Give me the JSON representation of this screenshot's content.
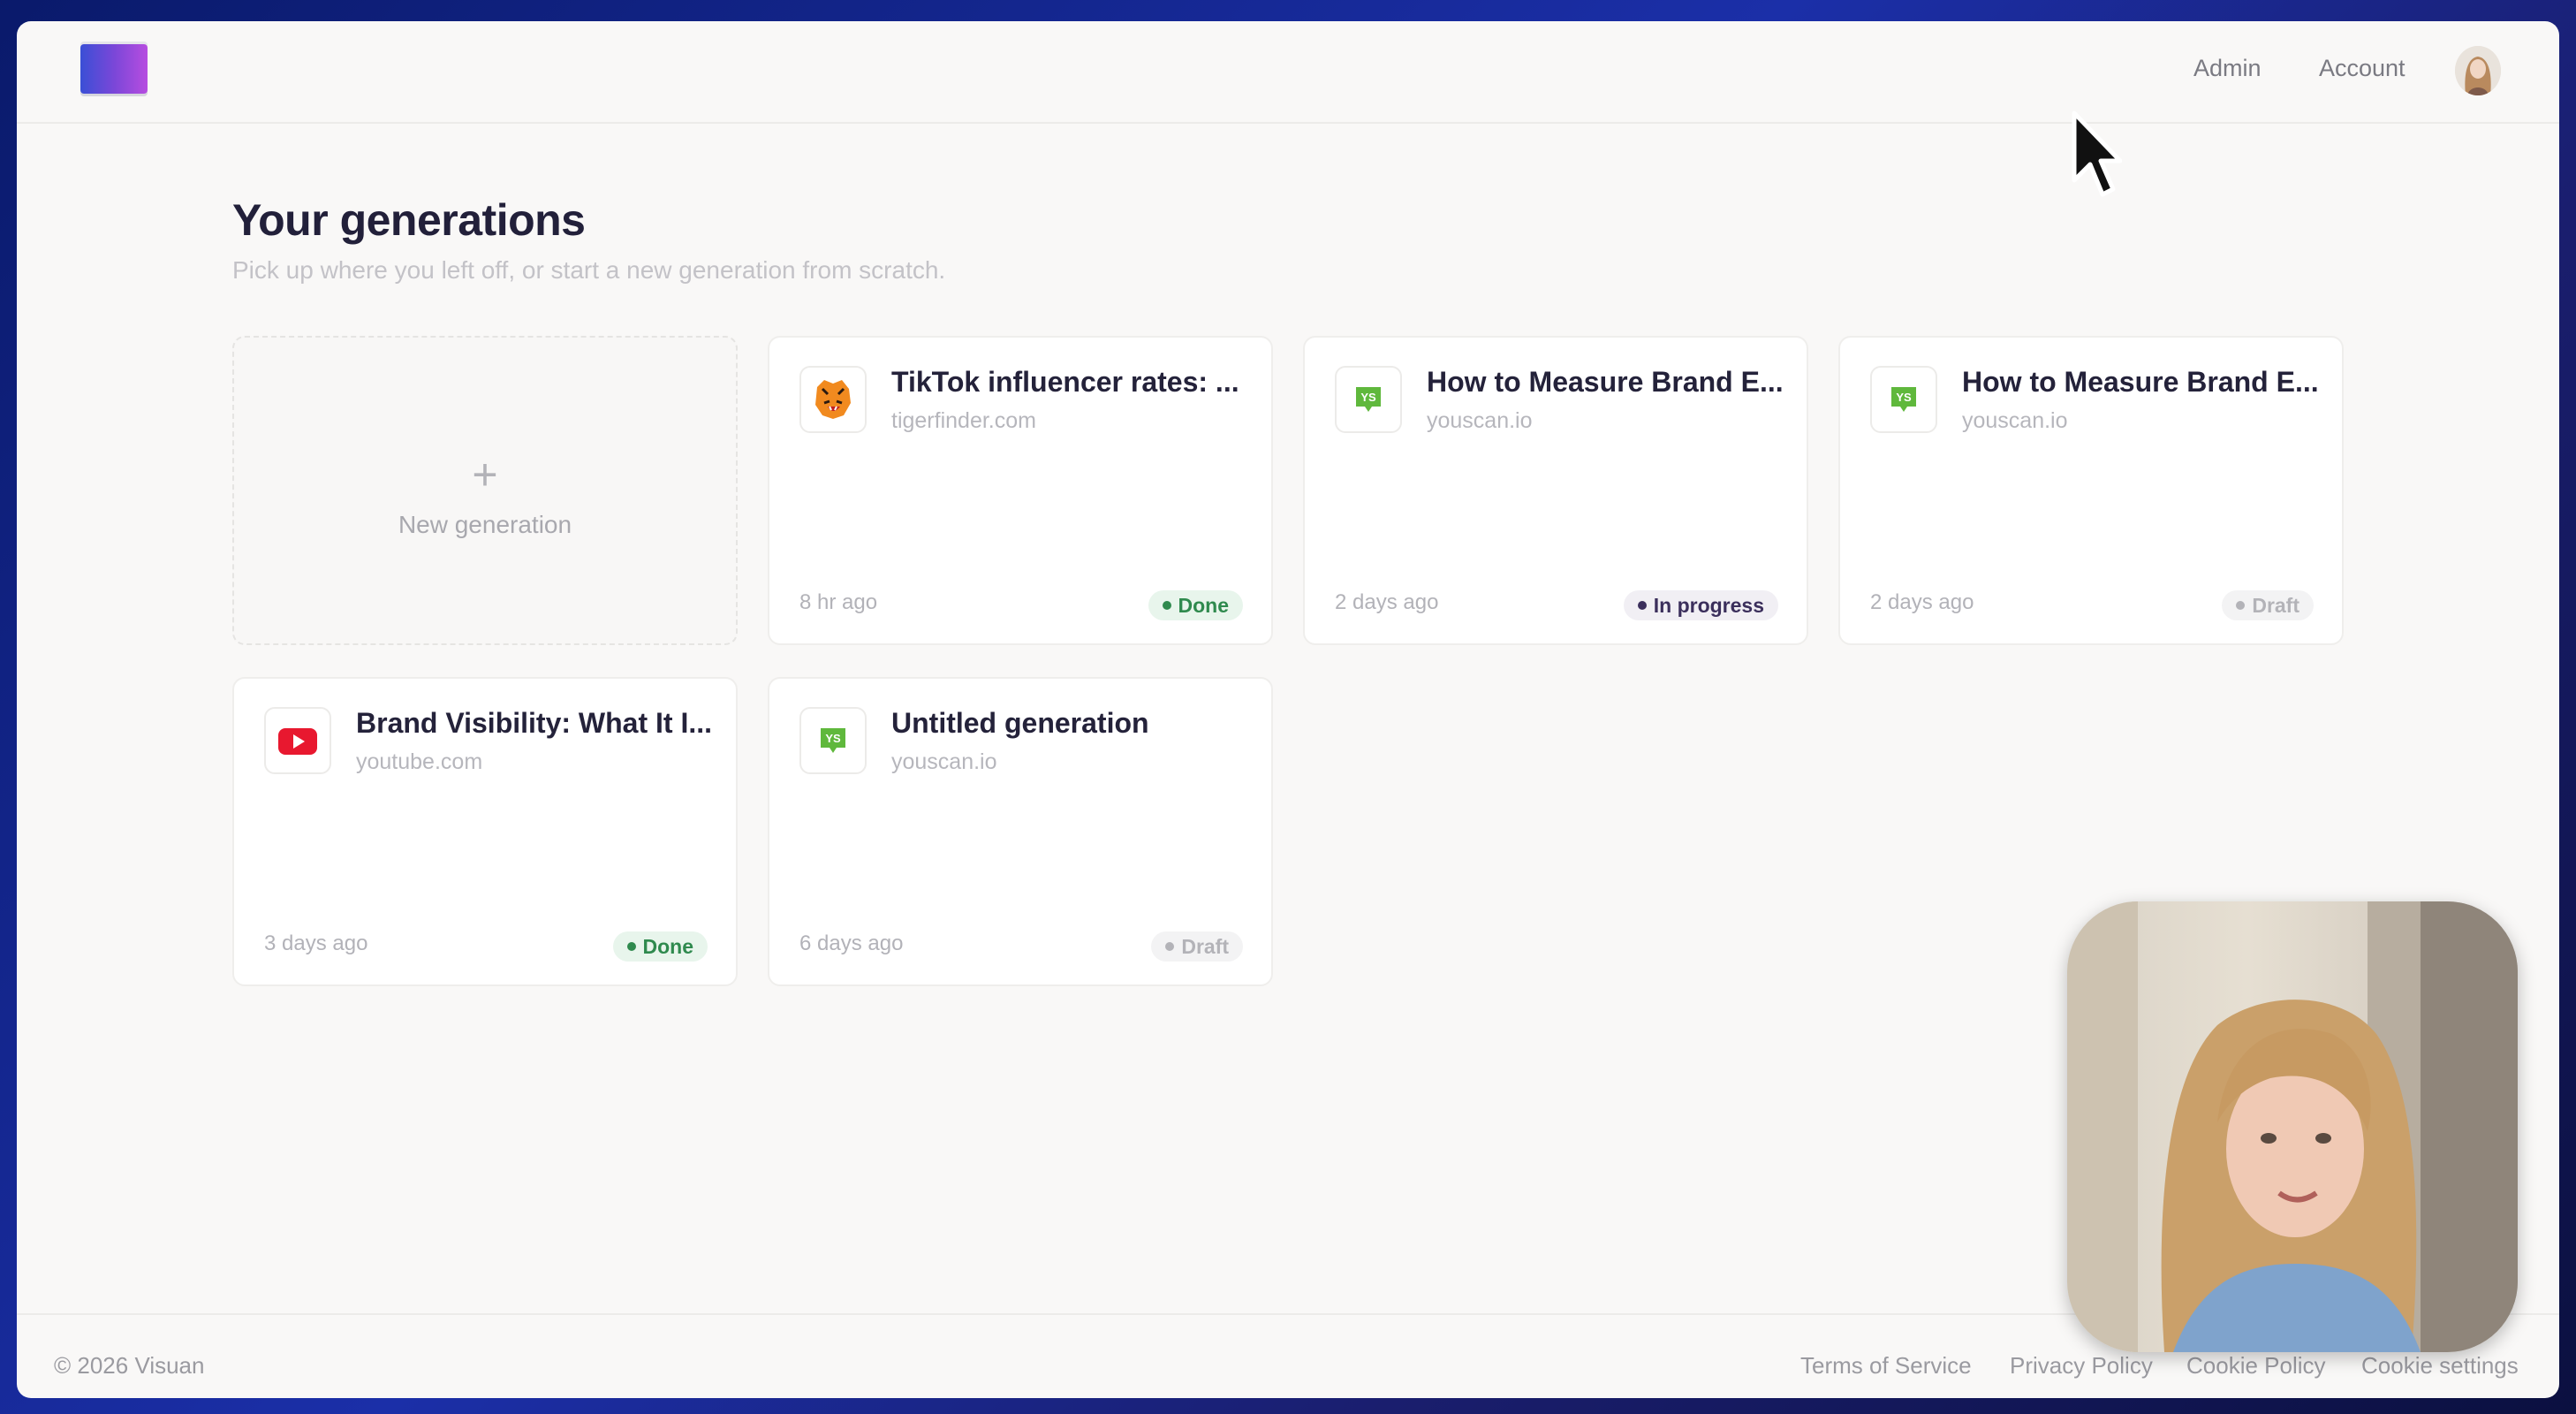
{
  "app": {
    "logo_name": "visuan-logo"
  },
  "nav": {
    "admin": "Admin",
    "account": "Account"
  },
  "main": {
    "title": "Your generations",
    "subtitle": "Pick up where you left off, or start a new generation from scratch."
  },
  "new_card": {
    "icon": "+",
    "label": "New generation"
  },
  "cards": [
    {
      "title": "TikTok influencer rates: ...",
      "domain": "tigerfinder.com",
      "time": "8 hr ago",
      "status": "Done",
      "icon": "tiger-icon"
    },
    {
      "title": "How to Measure Brand E...",
      "domain": "youscan.io",
      "time": "2 days ago",
      "status": "In progress",
      "icon": "youscan-icon"
    },
    {
      "title": "How to Measure Brand E...",
      "domain": "youscan.io",
      "time": "2 days ago",
      "status": "Draft",
      "icon": "youscan-icon"
    },
    {
      "title": "Brand Visibility: What It I...",
      "domain": "youtube.com",
      "time": "3 days ago",
      "status": "Done",
      "icon": "youtube-icon"
    },
    {
      "title": "Untitled generation",
      "domain": "youscan.io",
      "time": "6 days ago",
      "status": "Draft",
      "icon": "youscan-icon"
    }
  ],
  "footer": {
    "copyright": "© 2026 Visuan",
    "links": [
      "Terms of Service",
      "Privacy Policy",
      "Cookie Policy",
      "Cookie settings"
    ]
  },
  "colors": {
    "done": "#2f8a4e",
    "in_progress": "#3b2f5c",
    "draft": "#b3b3b8",
    "youscan": "#5fb83c",
    "youtube": "#e8182f"
  }
}
